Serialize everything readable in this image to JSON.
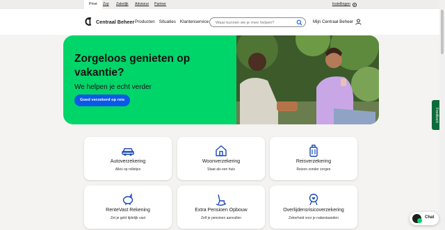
{
  "topbar": {
    "segments": [
      "Privé",
      "Zzp",
      "Zakelijk",
      "Adviseur",
      "Partner"
    ],
    "settings_label": "Instellingen"
  },
  "header": {
    "brand": "Centraal Beheer",
    "nav": [
      "Producten",
      "Situaties",
      "Klantenservice"
    ],
    "search_placeholder": "Waar kunnen we je mee helpen?",
    "account_label": "Mijn Centraal Beheer"
  },
  "hero": {
    "title": "Zorgeloos genieten op vakantie?",
    "subtitle": "We helpen je echt verder",
    "cta_label": "Goed verzekerd op reis"
  },
  "feedback_label": "Feedback",
  "cards": [
    {
      "title": "Autoverzekering",
      "subtitle": "Alles op rolletjes",
      "icon": "car-icon"
    },
    {
      "title": "Woonverzekering",
      "subtitle": "Staat als een huis",
      "icon": "house-icon"
    },
    {
      "title": "Reisverzekering",
      "subtitle": "Reizen zonder zorgen",
      "icon": "suitcase-icon"
    },
    {
      "title": "RenteVast Rekening",
      "subtitle": "Zet je geld tijdelijk vast",
      "icon": "piggy-bank-icon"
    },
    {
      "title": "Extra Pensioen Opbouw",
      "subtitle": "Zelf je pensioen aanvullen",
      "icon": "rocking-chair-icon"
    },
    {
      "title": "Overlijdensrisicoverzekering",
      "subtitle": "Zekerheid voor je nabestaanden",
      "icon": "heart-ribbon-icon"
    }
  ],
  "chat_label": "Chat",
  "colors": {
    "brand_green": "#00d56a",
    "cta_blue": "#0a59e8",
    "feedback_green": "#0e6b3b"
  }
}
